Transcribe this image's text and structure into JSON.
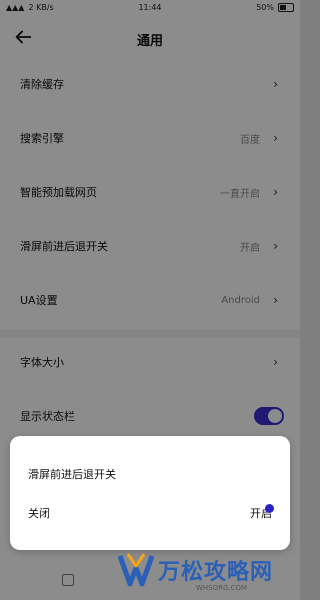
{
  "status_bar": {
    "signal": "▲▲▲",
    "speed": "2 KB/s",
    "time": "11:44",
    "battery": "50%"
  },
  "header": {
    "title": "通用"
  },
  "settings": {
    "items": [
      {
        "label": "清除缓存",
        "value": ""
      },
      {
        "label": "搜索引擎",
        "value": "百度"
      },
      {
        "label": "智能预加载网页",
        "value": "一直开启"
      },
      {
        "label": "滑屏前进后退开关",
        "value": "开启"
      },
      {
        "label": "UA设置",
        "value": "Android"
      },
      {
        "label": "字体大小",
        "value": ""
      },
      {
        "label": "显示状态栏",
        "value": ""
      }
    ],
    "status_bar_toggle_on": true
  },
  "dialog": {
    "title": "滑屏前进后退开关",
    "option_off": "关闭",
    "option_on": "开启",
    "selected": "开启"
  },
  "watermark": {
    "brand": "万松攻略网",
    "site": "WHSORG.COM"
  },
  "colors": {
    "accent": "#3a2fd6",
    "watermark": "#2b5fb8"
  }
}
